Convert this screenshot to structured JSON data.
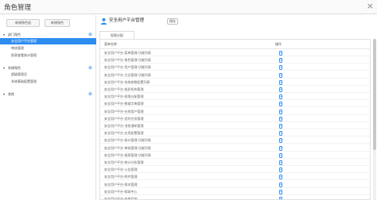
{
  "window": {
    "title": "角色管理",
    "close": "×"
  },
  "left": {
    "buttons": [
      "新增角色组",
      "新增角色"
    ],
    "groups": [
      {
        "label": "部门角色",
        "items": [
          "安全用户平台管理",
          "审核管理",
          "报表查看统计管理"
        ]
      },
      {
        "label": "系统角色",
        "items": [
          "超级管理员",
          "系统基础配置管理"
        ]
      },
      {
        "label": "其他",
        "items": []
      }
    ],
    "active_item": "安全用户平台管理"
  },
  "right": {
    "title": "安全用户平台管理",
    "save_label": "保存",
    "subtab": "权限分配",
    "columns": {
      "name": "菜单名称",
      "op": "操作"
    },
    "rows": [
      "安全用户平台-菜单管理-功能列表",
      "安全用户平台-角色管理-功能列表",
      "安全用户平台-用户管理-功能列表",
      "安全用户平台-日志管理-功能列表",
      "安全用户平台-系统参数配置列表",
      "安全用户平台-组织机构管理",
      "安全用户平台-权限分配管理",
      "安全用户平台-数据字典管理",
      "安全用户平台-在线用户管理",
      "安全用户平台-定时任务管理",
      "安全用户平台-消息通知管理",
      "安全用户平台-应用配置管理",
      "安全用户平台-接口管理-功能列表",
      "安全用户平台-审核管理-功能列表",
      "安全用户平台-报表管理-功能列表",
      "安全用户平台-统计分析管理",
      "安全用户平台-公告管理",
      "安全用户平台-附件管理",
      "安全用户平台-版本管理",
      "安全用户平台-帮助中心",
      "安全用户平台-系统监控"
    ]
  },
  "colors": {
    "accent": "#2d8cf0",
    "active_text": "#ffffff"
  },
  "icons": {
    "user": "user-icon",
    "pin": "pin-icon",
    "edit": "edit-icon",
    "close": "close-icon"
  }
}
